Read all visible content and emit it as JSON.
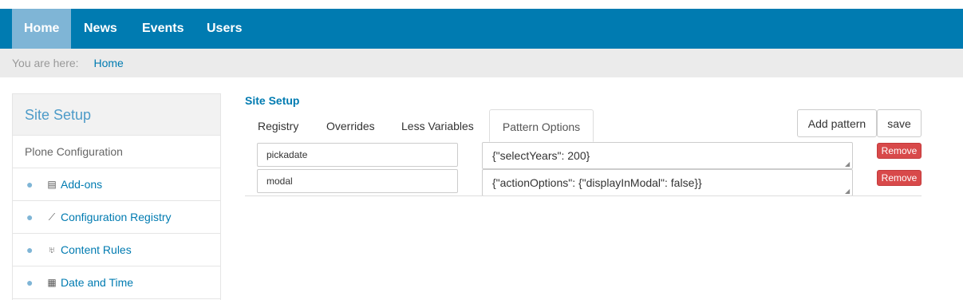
{
  "nav": {
    "items": [
      {
        "label": "Home"
      },
      {
        "label": "News"
      },
      {
        "label": "Events"
      },
      {
        "label": "Users"
      }
    ]
  },
  "breadcrumbs": {
    "prefix": "You are here:",
    "items": [
      {
        "label": "Home"
      }
    ]
  },
  "sidebar": {
    "title": "Site Setup",
    "section": "Plone Configuration",
    "items": [
      {
        "label": "Add-ons",
        "icon": "addons-icon"
      },
      {
        "label": "Configuration Registry",
        "icon": "wrench-icon"
      },
      {
        "label": "Content Rules",
        "icon": "content-rules-icon"
      },
      {
        "label": "Date and Time",
        "icon": "calendar-icon"
      }
    ]
  },
  "main": {
    "title": "Site Setup",
    "tabs": [
      {
        "label": "Registry"
      },
      {
        "label": "Overrides"
      },
      {
        "label": "Less Variables"
      },
      {
        "label": "Pattern Options"
      }
    ],
    "active_tab": "Pattern Options",
    "add_pattern_label": "Add pattern",
    "save_label": "save",
    "patterns": [
      {
        "name": "pickadate",
        "options": "{\"selectYears\": 200}",
        "remove_label": "Remove"
      },
      {
        "name": "modal",
        "options": "{\"actionOptions\": {\"displayInModal\": false}}",
        "remove_label": "Remove"
      }
    ]
  },
  "colors": {
    "primary": "#007bb1",
    "active_nav": "#7fb5d6",
    "danger": "#d8494a"
  }
}
